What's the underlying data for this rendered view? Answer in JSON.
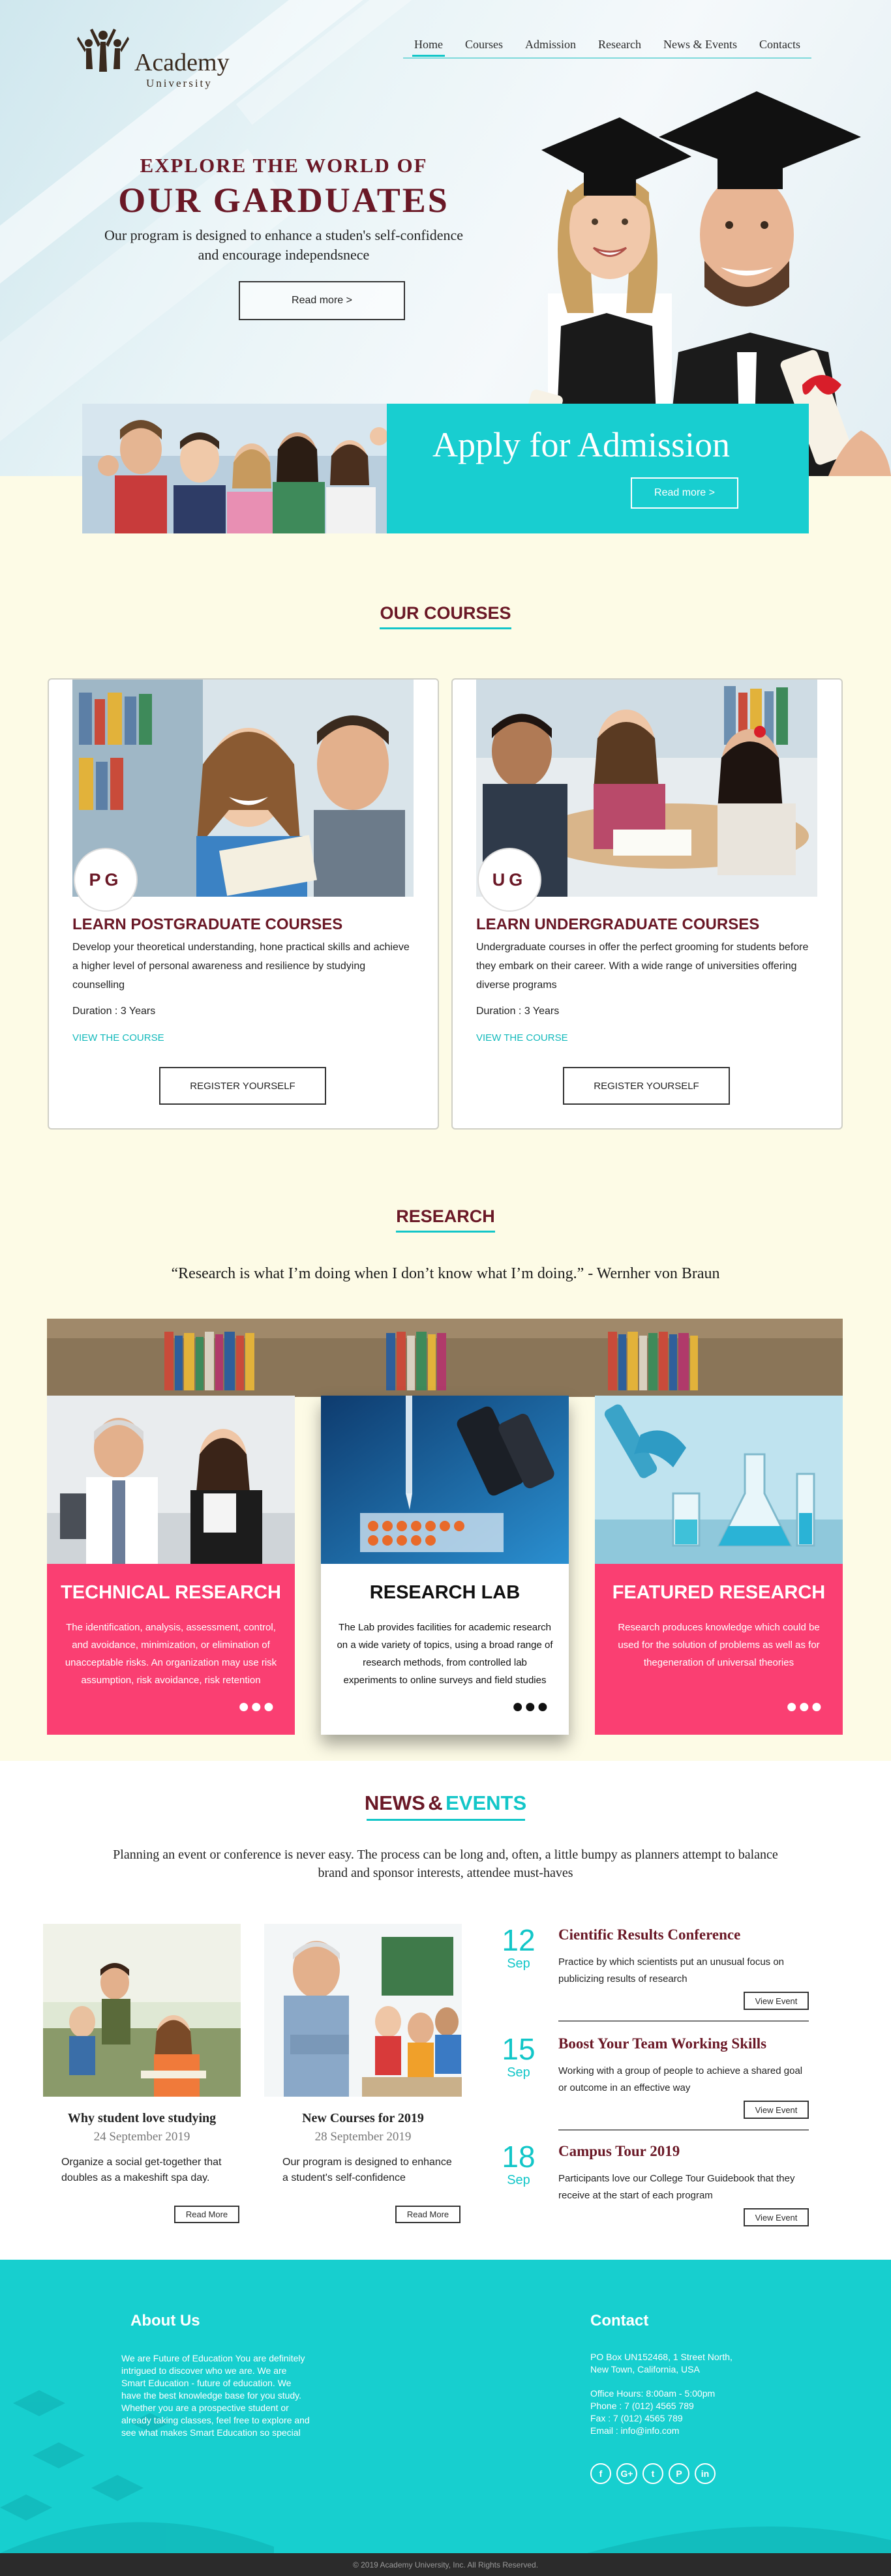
{
  "colors": {
    "accent": "#12c6c8",
    "maroon": "#6a1826",
    "pink": "#fa3f72",
    "cream": "#fdfbe6"
  },
  "brand": {
    "name": "Academy",
    "sub": "University",
    "logo_icon": "people-raised-arms-icon"
  },
  "nav": {
    "items": [
      "Home",
      "Courses",
      "Admission",
      "Research",
      "News & Events",
      "Contacts"
    ],
    "active": "Home"
  },
  "hero": {
    "kicker": "EXPLORE THE WORLD OF",
    "title": "OUR GARDUATES",
    "desc_line1": "Our program is designed to enhance a studen's self-confidence",
    "desc_line2": "and encourage independsnece",
    "button": "Read more >"
  },
  "admission": {
    "title": "Apply for Admission",
    "button": "Read more >"
  },
  "courses": {
    "heading": "OUR COURSES",
    "items": [
      {
        "badge": "PG",
        "title": "LEARN  POSTGRADUATE COURSES",
        "desc": "Develop your theoretical understanding, hone practical skills and achieve a higher level of personal awareness and resilience by studying counselling",
        "duration": "Duration :  3 Years",
        "link": "VIEW THE COURSE",
        "button": "REGISTER YOURSELF"
      },
      {
        "badge": "UG",
        "title": "LEARN  UNDERGRADUATE COURSES",
        "desc": "Undergraduate courses in offer the perfect grooming for students before they embark on their career. With a wide range of universities offering diverse programs",
        "duration": "Duration :  3 Years",
        "link": "VIEW THE COURSE",
        "button": "REGISTER YOURSELF"
      }
    ]
  },
  "research": {
    "heading": "RESEARCH",
    "quote": "“Research is what I’m doing when I don’t know what I’m doing.” - Wernher von Braun",
    "cards": [
      {
        "title": "TECHNICAL RESEARCH",
        "desc": "The identification, analysis, assessment, control, and avoidance, minimization, or elimination of unacceptable risks. An organization may use risk assumption, risk avoidance, risk retention",
        "more": "●●●"
      },
      {
        "title": "RESEARCH LAB",
        "desc": "The Lab provides facilities for academic research on a wide variety of topics, using a broad range of research methods, from controlled lab experiments to online surveys and field studies",
        "more": "●●●"
      },
      {
        "title": "FEATURED RESEARCH",
        "desc": "Research produces knowledge which could be used for the solution of problems as well as for thegeneration of universal theories",
        "more": "●●●"
      }
    ]
  },
  "news": {
    "heading1": "NEWS",
    "amp": "&",
    "heading2": "EVENTS",
    "intro": "Planning an event or conference is never easy. The process can be long and, often, a little bumpy as planners attempt to balance brand and sponsor interests, attendee must-haves",
    "articles": [
      {
        "title": "Why student love studying",
        "date": "24 September 2019",
        "desc": "Organize a social get-together that doubles as a makeshift spa day.",
        "button": "Read More"
      },
      {
        "title": "New Courses for 2019",
        "date": "28 September 2019",
        "desc": "Our program is designed to enhance a student's self-confidence",
        "button": "Read More"
      }
    ],
    "events": [
      {
        "day": "12",
        "month": "Sep",
        "title": "Cientific Results Conference",
        "desc": "Practice by which scientists put an unusual focus on publicizing results of research",
        "button": "View Event"
      },
      {
        "day": "15",
        "month": "Sep",
        "title": "Boost Your Team Working Skills",
        "desc": "Working with a group of people to achieve a shared goal or outcome in an effective way",
        "button": "View Event"
      },
      {
        "day": "18",
        "month": "Sep",
        "title": "Campus Tour 2019",
        "desc": "Participants love our College Tour Guidebook that they receive at the start of each program",
        "button": "View Event"
      }
    ]
  },
  "footer": {
    "about_title": "About Us",
    "about_text": "We are Future of Education You are definitely intrigued to discover who we are. We are Smart Education - future of education. We have the best knowledge base for you study. Whether you are a prospective student or already taking classes, feel free to explore and see what makes Smart Education so special",
    "contact_title": "Contact",
    "address1": "PO Box UN152468, 1 Street North,",
    "address2": "New Town, California, USA",
    "hours": "Office Hours: 8:00am - 5:00pm",
    "phone": "Phone : 7 (012) 4565 789",
    "fax": "Fax :      7 (012) 4565 789",
    "email": "Email :  info@info.com",
    "socials": [
      "f",
      "G+",
      "t",
      "P",
      "in"
    ],
    "social_icons": [
      "facebook-icon",
      "google-plus-icon",
      "twitter-icon",
      "pinterest-icon",
      "linkedin-icon"
    ],
    "copyright": "© 2019 Academy University, Inc. All Rights Reserved."
  }
}
